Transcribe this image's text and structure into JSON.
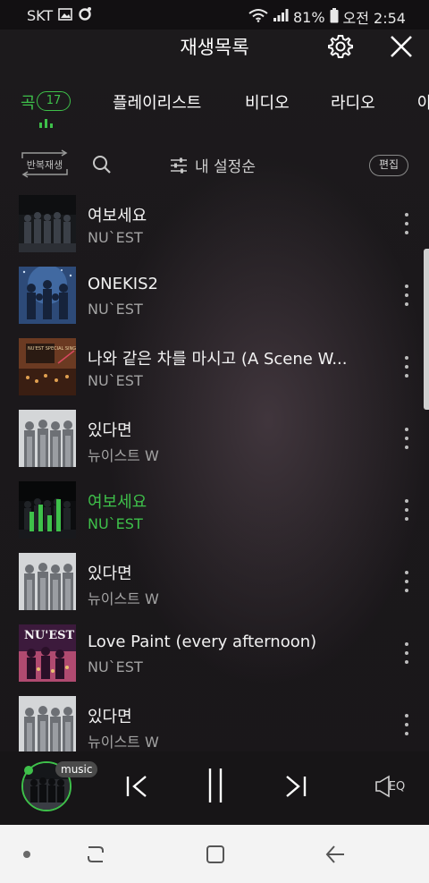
{
  "status_bar": {
    "carrier": "SKT",
    "battery": "81%",
    "time": "오전 2:54"
  },
  "header": {
    "title": "재생목록",
    "icons": [
      "gear-icon",
      "close-icon"
    ]
  },
  "tabs": [
    {
      "label": "곡",
      "active": true,
      "count": "17"
    },
    {
      "label": "플레이리스트",
      "active": false
    },
    {
      "label": "비디오",
      "active": false
    },
    {
      "label": "라디오",
      "active": false
    },
    {
      "label": "아",
      "active": false
    }
  ],
  "toolbar": {
    "repeat_label": "반복재생",
    "sort_label": "내 설정순",
    "edit_label": "편집"
  },
  "songs": [
    {
      "title": "여보세요",
      "artist": "NU`EST",
      "playing": false,
      "art": "dark-group"
    },
    {
      "title": "ONEKIS2",
      "artist": "NU`EST",
      "playing": false,
      "art": "blue-group"
    },
    {
      "title": "나와 같은 차를 마시고 (A Scene W...",
      "artist": "NU`EST",
      "playing": false,
      "art": "warm-single"
    },
    {
      "title": "있다면",
      "artist": "뉴이스트 W",
      "playing": false,
      "art": "grey-quartet"
    },
    {
      "title": "여보세요",
      "artist": "NU`EST",
      "playing": true,
      "art": "dark-group"
    },
    {
      "title": "있다면",
      "artist": "뉴이스트 W",
      "playing": false,
      "art": "grey-quartet"
    },
    {
      "title": "Love Paint (every afternoon)",
      "artist": "NU`EST",
      "playing": false,
      "art": "nuest-canvas"
    },
    {
      "title": "있다면",
      "artist": "뉴이스트 W",
      "playing": false,
      "art": "grey-quartet"
    }
  ],
  "album_art_texts": {
    "warm_single": "NU'EST SPECIAL SINGLE",
    "nuest_canvas": "NU'EST"
  },
  "player": {
    "chip_label": "music",
    "eq_label": "EQ",
    "state": "playing"
  },
  "colors": {
    "accent": "#3ec04a",
    "background": "#1b181b",
    "navbar": "#f3f3f3"
  }
}
